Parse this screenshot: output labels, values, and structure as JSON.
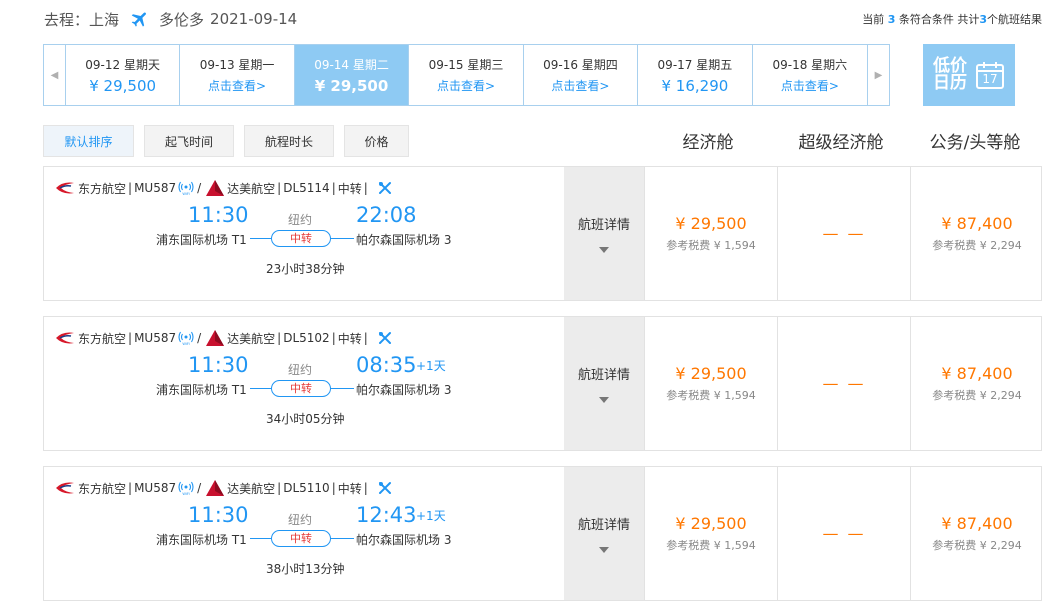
{
  "header": {
    "label": "去程：上海",
    "destination": "多伦多",
    "date": "2021-09-14"
  },
  "summary": {
    "prefix": "当前",
    "count_match": "3",
    "middle": "条符合条件 共计",
    "count_total": "3",
    "suffix": "个航班结果"
  },
  "date_bar": [
    {
      "date": "09-12 星期天",
      "value": "¥ 29,500",
      "is_link": false,
      "active": false
    },
    {
      "date": "09-13 星期一",
      "value": "点击查看>",
      "is_link": true,
      "active": false
    },
    {
      "date": "09-14 星期二",
      "value": "¥ 29,500",
      "is_link": false,
      "active": true
    },
    {
      "date": "09-15 星期三",
      "value": "点击查看>",
      "is_link": true,
      "active": false
    },
    {
      "date": "09-16 星期四",
      "value": "点击查看>",
      "is_link": true,
      "active": false
    },
    {
      "date": "09-17 星期五",
      "value": "¥ 16,290",
      "is_link": false,
      "active": false
    },
    {
      "date": "09-18 星期六",
      "value": "点击查看>",
      "is_link": true,
      "active": false
    }
  ],
  "low_price_calendar": {
    "label_line1": "低价",
    "label_line2": "日历",
    "day": "17"
  },
  "sort_buttons": [
    "默认排序",
    "起飞时间",
    "航程时长",
    "价格"
  ],
  "cabins": [
    "经济舱",
    "超级经济舱",
    "公务/头等舱"
  ],
  "flights": [
    {
      "airline1": "东方航空",
      "code1": "MU587",
      "airline2": "达美航空",
      "code2": "DL5114",
      "transfer_tag": "中转",
      "dep_time": "11:30",
      "via": "纽约",
      "arr_time": "22:08",
      "next_day": "",
      "dep_airport": "浦东国际机场 T1",
      "transfer_label": "中转",
      "arr_airport": "帕尔森国际机场 3",
      "duration": "23小时38分钟",
      "detail_label": "航班详情",
      "econ_price": "¥ 29,500",
      "econ_tax": "参考税费 ¥ 1,594",
      "super_price": "— —",
      "biz_price": "¥ 87,400",
      "biz_tax": "参考税费 ¥ 2,294"
    },
    {
      "airline1": "东方航空",
      "code1": "MU587",
      "airline2": "达美航空",
      "code2": "DL5102",
      "transfer_tag": "中转",
      "dep_time": "11:30",
      "via": "纽约",
      "arr_time": "08:35",
      "next_day": "+1天",
      "dep_airport": "浦东国际机场 T1",
      "transfer_label": "中转",
      "arr_airport": "帕尔森国际机场 3",
      "duration": "34小时05分钟",
      "detail_label": "航班详情",
      "econ_price": "¥ 29,500",
      "econ_tax": "参考税费 ¥ 1,594",
      "super_price": "— —",
      "biz_price": "¥ 87,400",
      "biz_tax": "参考税费 ¥ 2,294"
    },
    {
      "airline1": "东方航空",
      "code1": "MU587",
      "airline2": "达美航空",
      "code2": "DL5110",
      "transfer_tag": "中转",
      "dep_time": "11:30",
      "via": "纽约",
      "arr_time": "12:43",
      "next_day": "+1天",
      "dep_airport": "浦东国际机场 T1",
      "transfer_label": "中转",
      "arr_airport": "帕尔森国际机场 3",
      "duration": "38小时13分钟",
      "detail_label": "航班详情",
      "econ_price": "¥ 29,500",
      "econ_tax": "参考税费 ¥ 1,594",
      "super_price": "— —",
      "biz_price": "¥ 87,400",
      "biz_tax": "参考税费 ¥ 2,294"
    }
  ],
  "colors": {
    "accent": "#2196f3",
    "price": "#ff7700",
    "active_date_bg": "#8ecaf3",
    "transfer_text": "#e53935"
  },
  "icons": {
    "plane": "plane-icon",
    "china_eastern": "china-eastern-logo-icon",
    "delta": "delta-logo-icon",
    "wifi": "wifi-icon",
    "meal": "meal-icon",
    "calendar": "calendar-icon"
  }
}
